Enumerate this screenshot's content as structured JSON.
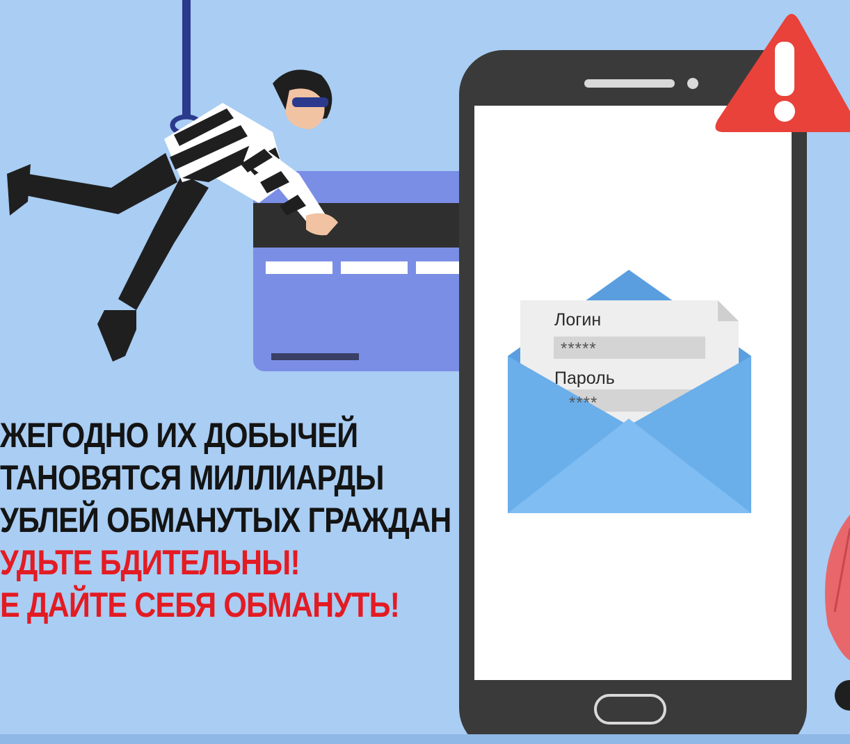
{
  "headline": {
    "line1": "ЖЕГОДНО ИХ ДОБЫЧЕЙ",
    "line2": "ТАНОВЯТСЯ МИЛЛИАРДЫ",
    "line3": "УБЛЕЙ ОБМАНУТЫХ ГРАЖДАН",
    "line4": "УДЬТЕ БДИТЕЛЬНЫ!",
    "line5": "Е ДАЙТЕ СЕБЯ ОБМАНУТЬ!"
  },
  "form": {
    "login_label": "Логин",
    "login_value": "*****",
    "password_label": "Пароль",
    "password_value": "****"
  },
  "colors": {
    "background": "#a9cdf3",
    "accent_red": "#e31b23",
    "card": "#7b8ee6",
    "envelope": "#5b9ee0",
    "phone": "#3a3a3a"
  },
  "icons": [
    "warning-triangle-icon",
    "thief-illustration",
    "bank-card-illustration",
    "envelope-icon",
    "smartphone-illustration",
    "plant-leaf-illustration"
  ]
}
